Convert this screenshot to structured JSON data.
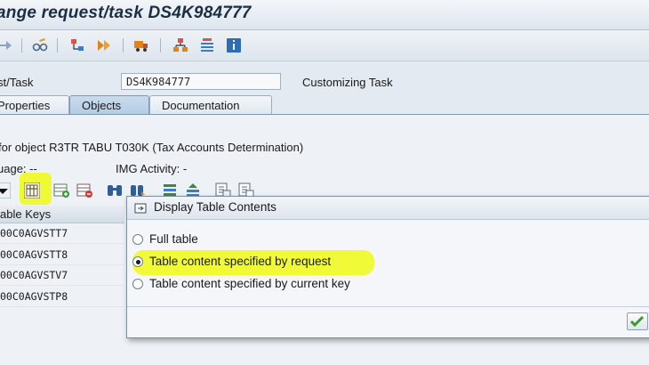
{
  "window": {
    "title": "ange request/task DS4K984777"
  },
  "header": {
    "field_label": "st/Task",
    "field_value": "DS4K984777",
    "field_desc": "Customizing Task"
  },
  "tabs": [
    {
      "label": "Properties",
      "active": false
    },
    {
      "label": "Objects",
      "active": true
    },
    {
      "label": "Documentation",
      "active": false
    }
  ],
  "object_info": {
    "line": "for object R3TR TABU T030K (Tax Accounts Determination)",
    "language": "uage: --",
    "img_activity": "IMG Activity: -"
  },
  "grid": {
    "header": "able Keys",
    "rows": [
      "00C0AGVSTT7",
      "00C0AGVSTT8",
      "00C0AGVSTV7",
      "00C0AGVSTP8"
    ]
  },
  "dialog": {
    "title": "Display Table Contents",
    "options": [
      {
        "label": "Full table",
        "checked": false
      },
      {
        "label": "Table content specified by request",
        "checked": true
      },
      {
        "label": "Table content specified by current key",
        "checked": false
      }
    ]
  },
  "icons": {
    "toolbar": [
      "forward-arrow-icon",
      "glasses-pencil-icon",
      "hierarchy-icon",
      "release-icon",
      "truck-icon",
      "tree-icon",
      "list-icon",
      "info-icon"
    ],
    "object_toolbar": [
      "dropdown-icon",
      "table-contents-icon",
      "insert-row-icon",
      "delete-row-icon",
      "binoculars-icon",
      "find-next-icon",
      "filter-icon",
      "sort-icon",
      "select-all-icon",
      "deselect-icon"
    ],
    "ok": "checkmark-icon"
  },
  "colors": {
    "highlight": "#f0fa14",
    "selection_blue": "#b3cbe3"
  }
}
